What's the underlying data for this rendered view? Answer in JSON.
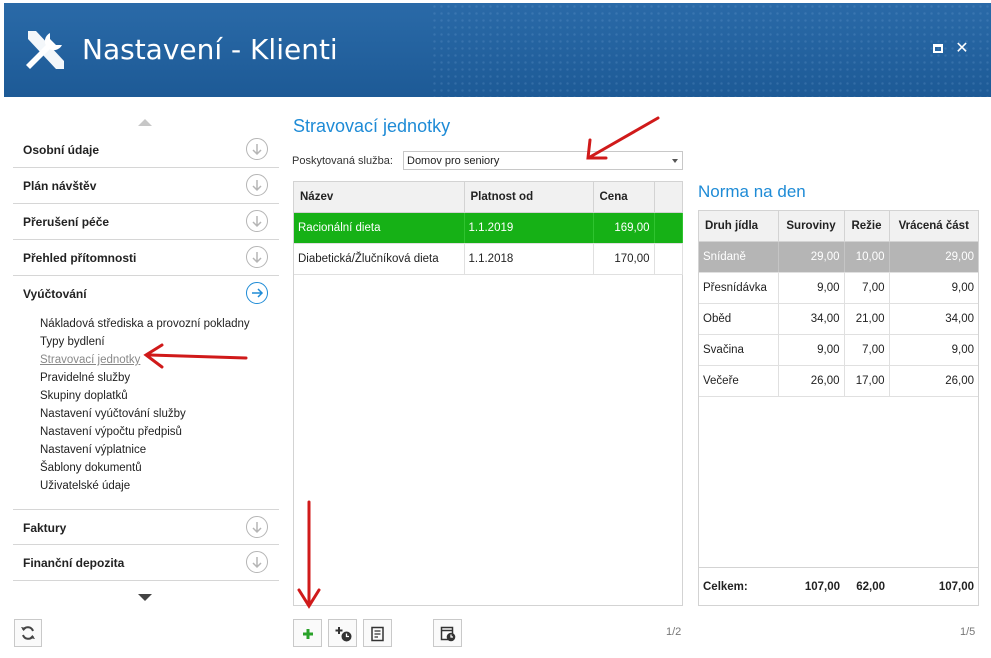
{
  "window": {
    "title": "Nastavení - Klienti"
  },
  "nav": {
    "sections": [
      {
        "label": "Osobní údaje",
        "state": "collapsed"
      },
      {
        "label": "Plán návštěv",
        "state": "collapsed"
      },
      {
        "label": "Přerušení péče",
        "state": "collapsed"
      },
      {
        "label": "Přehled přítomnosti",
        "state": "collapsed"
      },
      {
        "label": "Vyúčtování",
        "state": "active"
      },
      {
        "label": "Faktury",
        "state": "collapsed"
      },
      {
        "label": "Finanční depozita",
        "state": "collapsed"
      }
    ],
    "subitems": [
      {
        "label": "Nákladová střediska a provozní pokladny"
      },
      {
        "label": "Typy bydlení"
      },
      {
        "label": "Stravovací jednotky",
        "active": true
      },
      {
        "label": "Pravidelné služby"
      },
      {
        "label": "Skupiny doplatků"
      },
      {
        "label": "Nastavení vyúčtování služby"
      },
      {
        "label": "Nastavení výpočtu předpisů"
      },
      {
        "label": "Nastavení výplatnice"
      },
      {
        "label": "Šablony dokumentů"
      },
      {
        "label": "Uživatelské údaje"
      }
    ]
  },
  "main": {
    "title": "Stravovací jednotky",
    "service_label": "Poskytovaná služba:",
    "service_value": "Domov pro seniory",
    "columns": [
      "Název",
      "Platnost od",
      "Cena"
    ],
    "rows": [
      {
        "name": "Racionální dieta",
        "valid_from": "1.1.2019",
        "price": "169,00",
        "selected": true
      },
      {
        "name": "Diabetická/Žlučníková dieta",
        "valid_from": "1.1.2018",
        "price": "170,00",
        "selected": false
      }
    ],
    "pager": "1/2"
  },
  "norm": {
    "title": "Norma na den",
    "columns": [
      "Druh jídla",
      "Suroviny",
      "Režie",
      "Vrácená část"
    ],
    "rows": [
      {
        "meal": "Snídaně",
        "raw": "29,00",
        "overhead": "10,00",
        "returned": "29,00",
        "highlighted": true
      },
      {
        "meal": "Přesnídávka",
        "raw": "9,00",
        "overhead": "7,00",
        "returned": "9,00"
      },
      {
        "meal": "Oběd",
        "raw": "34,00",
        "overhead": "21,00",
        "returned": "34,00"
      },
      {
        "meal": "Svačina",
        "raw": "9,00",
        "overhead": "7,00",
        "returned": "9,00"
      },
      {
        "meal": "Večeře",
        "raw": "26,00",
        "overhead": "17,00",
        "returned": "26,00"
      }
    ],
    "total": {
      "label": "Celkem:",
      "raw": "107,00",
      "overhead": "62,00",
      "returned": "107,00"
    },
    "pager": "1/5"
  },
  "toolbar": {
    "icons": [
      "add-icon",
      "add-with-clock-icon",
      "edit-note-icon",
      "history-icon",
      "refresh-icon"
    ]
  },
  "colors": {
    "header": "#1f5c99",
    "accent": "#1e8bd6",
    "selected_row": "#16b116",
    "highlight_row": "#b5b5b5",
    "annotation": "#d01a1a"
  }
}
